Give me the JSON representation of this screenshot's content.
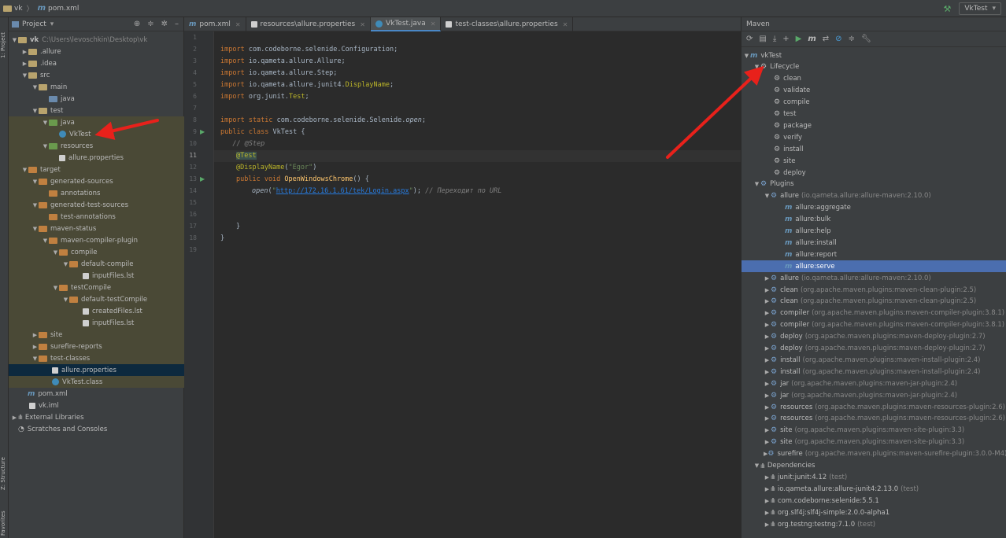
{
  "breadcrumb": {
    "project": "vk",
    "file": "pom.xml"
  },
  "run_config": "VkTest",
  "left_strip": {
    "project_tab": "1: Project",
    "structure_tab": "Z: Structure",
    "favorites_tab": "2: Favorites"
  },
  "project_panel": {
    "title": "Project",
    "rows": [
      {
        "label": "vk",
        "extra": "C:\\Users\\levoschkin\\Desktop\\vk",
        "bold": true
      },
      {
        "label": ".allure"
      },
      {
        "label": ".idea"
      },
      {
        "label": "src"
      },
      {
        "label": "main"
      },
      {
        "label": "java"
      },
      {
        "label": "test"
      },
      {
        "label": "java"
      },
      {
        "label": "VkTest"
      },
      {
        "label": "resources"
      },
      {
        "label": "allure.properties"
      },
      {
        "label": "target"
      },
      {
        "label": "generated-sources"
      },
      {
        "label": "annotations"
      },
      {
        "label": "generated-test-sources"
      },
      {
        "label": "test-annotations"
      },
      {
        "label": "maven-status"
      },
      {
        "label": "maven-compiler-plugin"
      },
      {
        "label": "compile"
      },
      {
        "label": "default-compile"
      },
      {
        "label": "inputFiles.lst"
      },
      {
        "label": "testCompile"
      },
      {
        "label": "default-testCompile"
      },
      {
        "label": "createdFiles.lst"
      },
      {
        "label": "inputFiles.lst"
      },
      {
        "label": "site"
      },
      {
        "label": "surefire-reports"
      },
      {
        "label": "test-classes"
      },
      {
        "label": "allure.properties"
      },
      {
        "label": "VkTest.class"
      },
      {
        "label": "pom.xml"
      },
      {
        "label": "vk.iml"
      },
      {
        "label": "External Libraries"
      },
      {
        "label": "Scratches and Consoles"
      }
    ]
  },
  "editor": {
    "tabs": [
      {
        "label": "pom.xml"
      },
      {
        "label": "resources\\allure.properties"
      },
      {
        "label": "VkTest.java"
      },
      {
        "label": "test-classes\\allure.properties"
      }
    ],
    "line_numbers": [
      "1",
      "2",
      "3",
      "4",
      "5",
      "6",
      "7",
      "8",
      "9",
      "10",
      "11",
      "12",
      "13",
      "14",
      "15",
      "16",
      "17",
      "18",
      "19"
    ],
    "code": {
      "l2_kw": "import",
      "l2_rest": " com.codeborne.selenide.Configuration;",
      "l3_kw": "import",
      "l3_rest": " io.qameta.allure.Allure;",
      "l4_kw": "import",
      "l4_rest": " io.qameta.allure.Step;",
      "l5_kw": "import",
      "l5_rest": " io.qameta.allure.junit4.",
      "l5_ann": "DisplayName",
      "l5_end": ";",
      "l6_kw": "import",
      "l6_rest": " org.junit.",
      "l6_ann": "Test",
      "l6_end": ";",
      "l8_kw": "import static",
      "l8_rest": " com.codeborne.selenide.Selenide.",
      "l8_it": "open",
      "l8_end": ";",
      "l9_kw": "public class",
      "l9_rest": " VkTest {",
      "l10": "   // @Step",
      "l11": "@Test",
      "l12_ann": "@DisplayName",
      "l12_p1": "(",
      "l12_str": "\"Egor\"",
      "l12_p2": ")",
      "l13_kw": "public void",
      "l13_fn": " OpenWindowsChrome",
      "l13_rest": "() {",
      "l14_it": "open",
      "l14_p1": "(",
      "l14_q1": "\"",
      "l14_url": "http://172.16.1.61/tek/Login.aspx",
      "l14_q2": "\"",
      "l14_p2": "); ",
      "l14_cm": "// Переходит по URL",
      "l17": "}",
      "l18": "}"
    }
  },
  "maven_panel": {
    "title": "Maven",
    "root": "vkTest",
    "lifecycle_label": "Lifecycle",
    "lifecycle": [
      "clean",
      "validate",
      "compile",
      "test",
      "package",
      "verify",
      "install",
      "site",
      "deploy"
    ],
    "plugins_label": "Plugins",
    "allure_expanded": {
      "name": "allure",
      "coord": "(io.qameta.allure:allure-maven:2.10.0)"
    },
    "allure_goals": [
      "allure:aggregate",
      "allure:bulk",
      "allure:help",
      "allure:install",
      "allure:report",
      "allure:serve"
    ],
    "selected_goal": "allure:serve",
    "plugins": [
      {
        "name": "allure",
        "coord": "(io.qameta.allure:allure-maven:2.10.0)"
      },
      {
        "name": "clean",
        "coord": "(org.apache.maven.plugins:maven-clean-plugin:2.5)"
      },
      {
        "name": "clean",
        "coord": "(org.apache.maven.plugins:maven-clean-plugin:2.5)"
      },
      {
        "name": "compiler",
        "coord": "(org.apache.maven.plugins:maven-compiler-plugin:3.8.1)"
      },
      {
        "name": "compiler",
        "coord": "(org.apache.maven.plugins:maven-compiler-plugin:3.8.1)"
      },
      {
        "name": "deploy",
        "coord": "(org.apache.maven.plugins:maven-deploy-plugin:2.7)"
      },
      {
        "name": "deploy",
        "coord": "(org.apache.maven.plugins:maven-deploy-plugin:2.7)"
      },
      {
        "name": "install",
        "coord": "(org.apache.maven.plugins:maven-install-plugin:2.4)"
      },
      {
        "name": "install",
        "coord": "(org.apache.maven.plugins:maven-install-plugin:2.4)"
      },
      {
        "name": "jar",
        "coord": "(org.apache.maven.plugins:maven-jar-plugin:2.4)"
      },
      {
        "name": "jar",
        "coord": "(org.apache.maven.plugins:maven-jar-plugin:2.4)"
      },
      {
        "name": "resources",
        "coord": "(org.apache.maven.plugins:maven-resources-plugin:2.6)"
      },
      {
        "name": "resources",
        "coord": "(org.apache.maven.plugins:maven-resources-plugin:2.6)"
      },
      {
        "name": "site",
        "coord": "(org.apache.maven.plugins:maven-site-plugin:3.3)"
      },
      {
        "name": "site",
        "coord": "(org.apache.maven.plugins:maven-site-plugin:3.3)"
      },
      {
        "name": "surefire",
        "coord": "(org.apache.maven.plugins:maven-surefire-plugin:3.0.0-M4)"
      }
    ],
    "dependencies_label": "Dependencies",
    "dependencies": [
      {
        "name": "junit:junit:4.12",
        "scope": "(test)"
      },
      {
        "name": "io.qameta.allure:allure-junit4:2.13.0",
        "scope": "(test)"
      },
      {
        "name": "com.codeborne:selenide:5.5.1",
        "scope": ""
      },
      {
        "name": "org.slf4j:slf4j-simple:2.0.0-alpha1",
        "scope": ""
      },
      {
        "name": "org.testng:testng:7.1.0",
        "scope": "(test)"
      }
    ]
  },
  "colors": {
    "accent": "#4b6eaf",
    "arrow": "#e8211b"
  }
}
